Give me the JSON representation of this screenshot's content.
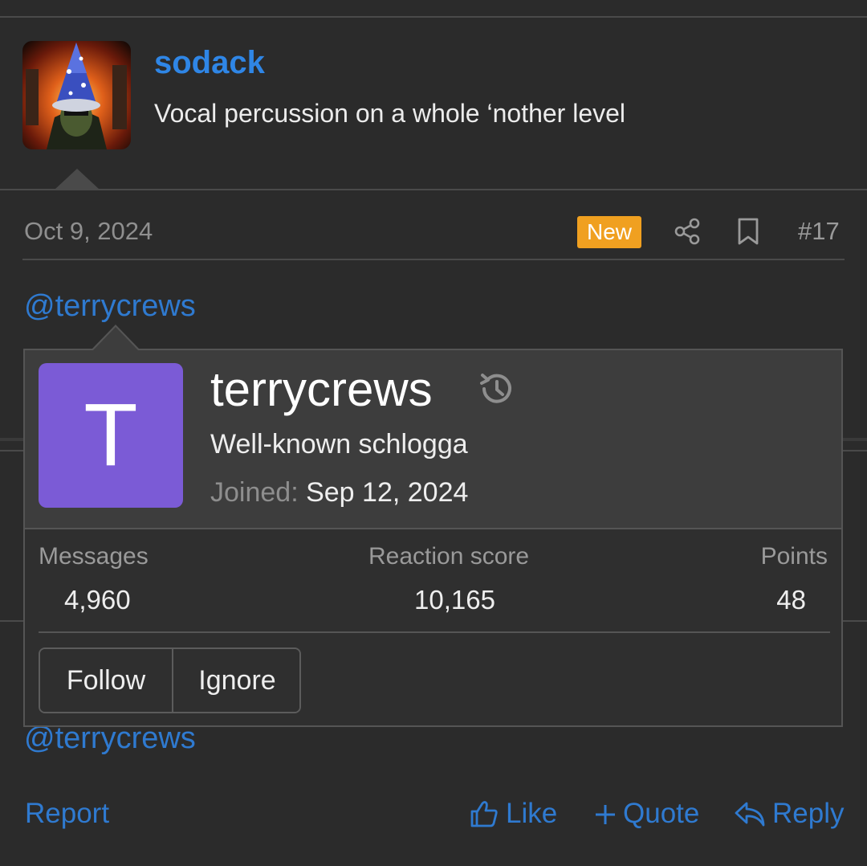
{
  "quote": {
    "author": "sodack",
    "text": "Vocal percussion on a whole ‘nother level",
    "avatar_icon": "wizard-avatar"
  },
  "post": {
    "date": "Oct 9, 2024",
    "badge": "New",
    "number": "#17",
    "mention_top": "@terrycrews",
    "mention_bottom": "@terrycrews"
  },
  "popup": {
    "avatar_letter": "T",
    "avatar_color": "#7b5bd6",
    "username": "terrycrews",
    "title": "Well-known schlogga",
    "joined_label": "Joined:",
    "joined_value": "Sep 12, 2024",
    "stats": {
      "messages_label": "Messages",
      "messages_value": "4,960",
      "reaction_label": "Reaction score",
      "reaction_value": "10,165",
      "points_label": "Points",
      "points_value": "48"
    },
    "buttons": {
      "follow": "Follow",
      "ignore": "Ignore"
    }
  },
  "footer": {
    "report": "Report",
    "like": "Like",
    "quote": "Quote",
    "reply": "Reply"
  },
  "colors": {
    "link": "#2f7ad0",
    "badge_new": "#f0a020",
    "background": "#2b2b2b"
  }
}
